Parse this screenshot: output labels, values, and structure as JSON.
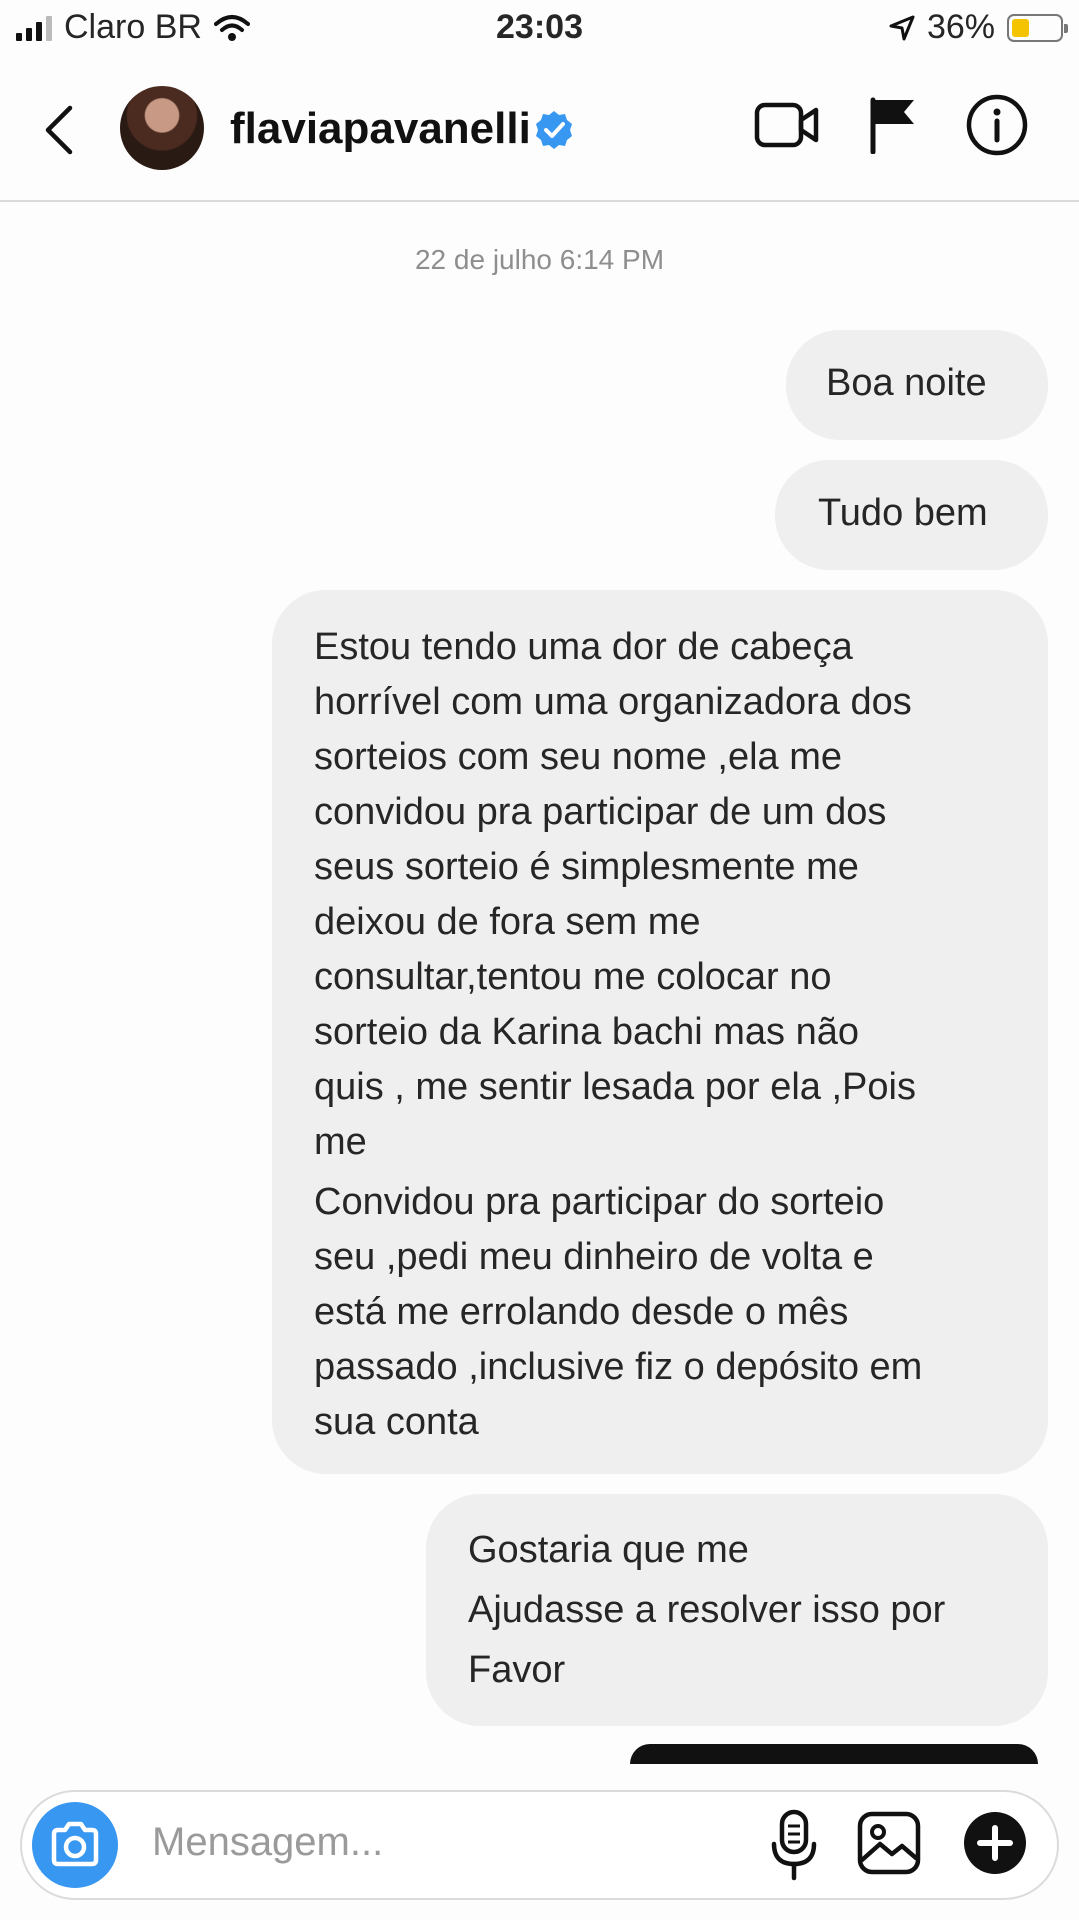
{
  "status_bar": {
    "carrier": "Claro BR",
    "time": "23:03",
    "battery_percent": "36%",
    "battery_level": 0.36,
    "battery_color": "#f5c400"
  },
  "header": {
    "username": "flaviapavanelli",
    "verified": true,
    "icons": [
      "back-chevron-icon",
      "video-call-icon",
      "flag-icon",
      "info-icon"
    ]
  },
  "conversation": {
    "date_label": "22 de julho 6:14 PM",
    "messages": [
      {
        "text": "Boa noite"
      },
      {
        "text": "Tudo bem"
      },
      {
        "lines": [
          "Estou tendo uma dor de cabeça",
          "horrível com uma organizadora dos",
          "sorteios com seu nome ,ela me",
          "convidou pra participar de um dos",
          "seus sorteio é simplesmente me",
          "deixou de fora sem me",
          "consultar,tentou me colocar no",
          "sorteio da Karina bachi mas não",
          "quis , me sentir lesada por ela ,Pois",
          "me",
          "Convidou pra participar do sorteio",
          "seu ,pedi meu dinheiro de volta e",
          "está me errolando desde o mês",
          "passado ,inclusive fiz o depósito em",
          "sua conta"
        ]
      },
      {
        "lines": [
          "Gostaria que me",
          "Ajudasse a resolver isso por",
          "Favor"
        ]
      }
    ]
  },
  "composer": {
    "placeholder": "Mensagem...",
    "accent": "#3897f0",
    "icons": [
      "camera-icon",
      "microphone-icon",
      "gallery-icon",
      "add-icon"
    ]
  }
}
